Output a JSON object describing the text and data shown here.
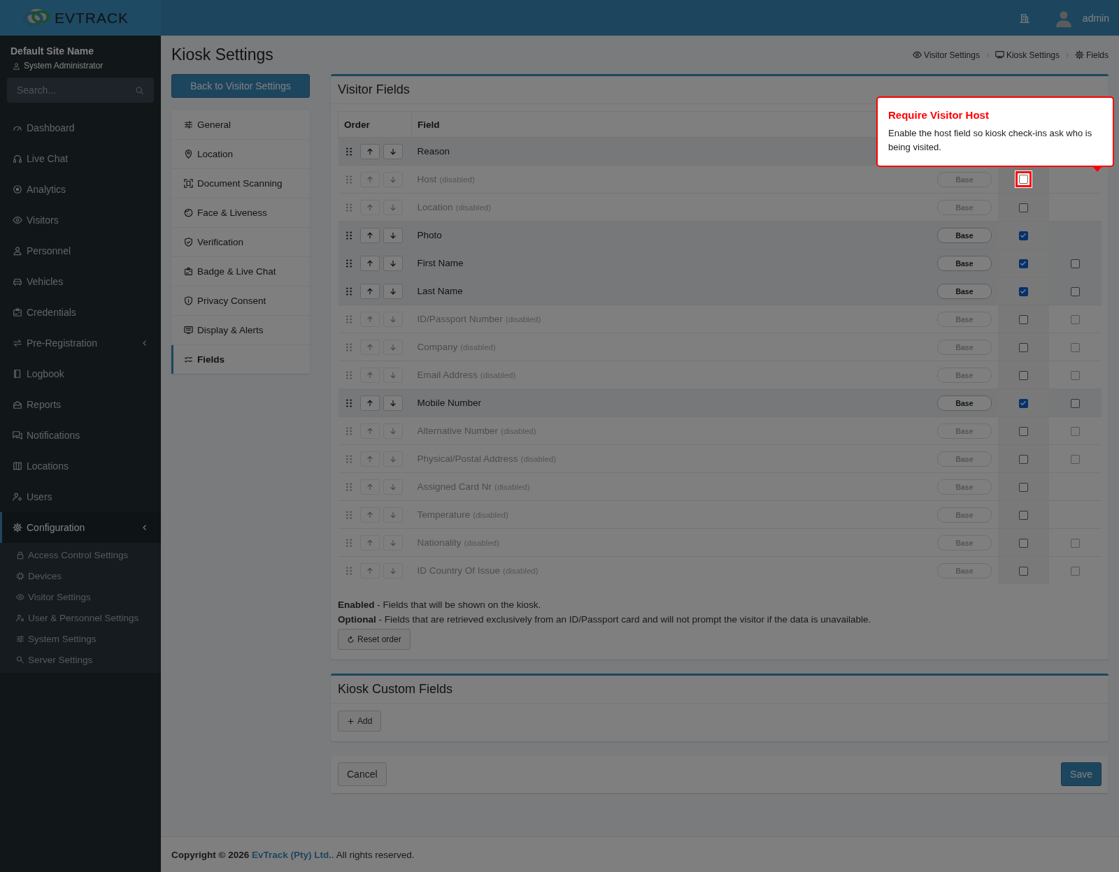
{
  "topbar": {
    "logo_text": "**EV**TRACK",
    "user": "admin"
  },
  "sidebar": {
    "site_name": "Default Site Name",
    "role": "System Administrator",
    "search": {
      "placeholder": "Search..."
    },
    "items": [
      {
        "label": "Dashboard",
        "kind": "link",
        "selected": false
      },
      {
        "label": "Live Chat",
        "kind": "link",
        "selected": false
      },
      {
        "label": "Analytics",
        "kind": "link",
        "selected": false
      },
      {
        "label": "Visitors",
        "kind": "link",
        "selected": false
      },
      {
        "label": "Personnel",
        "kind": "link",
        "selected": false
      },
      {
        "label": "Vehicles",
        "kind": "link",
        "selected": false
      },
      {
        "label": "Credentials",
        "kind": "link",
        "selected": false
      },
      {
        "label": "Pre-Registration",
        "kind": "group",
        "selected": false
      },
      {
        "label": "Logbook",
        "kind": "link",
        "selected": false
      },
      {
        "label": "Reports",
        "kind": "link",
        "selected": false
      },
      {
        "label": "Notifications",
        "kind": "link",
        "selected": false
      },
      {
        "label": "Locations",
        "kind": "link",
        "selected": false
      },
      {
        "label": "Users",
        "kind": "link",
        "selected": false
      },
      {
        "label": "Configuration",
        "kind": "group",
        "selected": true,
        "children": [
          {
            "label": "Access Control Settings"
          },
          {
            "label": "Devices"
          },
          {
            "label": "Visitor Settings"
          },
          {
            "label": "User & Personnel Settings"
          },
          {
            "label": "System Settings"
          },
          {
            "label": "Server Settings"
          }
        ]
      }
    ]
  },
  "page": {
    "title": "Kiosk Settings",
    "back_button": "Back to Visitor Settings",
    "breadcrumb": [
      "Visitor Settings",
      "Kiosk Settings",
      "Fields"
    ],
    "menu": [
      {
        "label": "General",
        "selected": false
      },
      {
        "label": "Location",
        "selected": false
      },
      {
        "label": "Document Scanning",
        "selected": false
      },
      {
        "label": "Face & Liveness",
        "selected": false
      },
      {
        "label": "Verification",
        "selected": false
      },
      {
        "label": "Badge & Live Chat",
        "selected": false
      },
      {
        "label": "Privacy Consent",
        "selected": false
      },
      {
        "label": "Display & Alerts",
        "selected": false
      },
      {
        "label": "Fields",
        "selected": true
      }
    ]
  },
  "visitor_fields": {
    "title": "Visitor Fields",
    "columns": [
      "Order",
      "Field"
    ],
    "rows": [
      {
        "field": "Reason",
        "disabled": false
      },
      {
        "field": "Host",
        "note": "(disabled)",
        "disabled": true,
        "badge": "Base",
        "enabled": false,
        "highlighted": true
      },
      {
        "field": "Location",
        "note": "(disabled)",
        "disabled": true,
        "badge": "Base",
        "enabled": false,
        "highlighted": false
      },
      {
        "field": "Photo",
        "disabled": false,
        "badge": "Base",
        "enabled": true,
        "highlighted": false
      },
      {
        "field": "First Name",
        "disabled": false,
        "badge": "Base",
        "enabled": true,
        "optional": false,
        "highlighted": false
      },
      {
        "field": "Last Name",
        "disabled": false,
        "badge": "Base",
        "enabled": true,
        "optional": false,
        "highlighted": false
      },
      {
        "field": "ID/Passport Number",
        "note": "(disabled)",
        "disabled": true,
        "badge": "Base",
        "enabled": false,
        "optional": false,
        "highlighted": false
      },
      {
        "field": "Company",
        "note": "(disabled)",
        "disabled": true,
        "badge": "Base",
        "enabled": false,
        "optional": false,
        "highlighted": false
      },
      {
        "field": "Email Address",
        "note": "(disabled)",
        "disabled": true,
        "badge": "Base",
        "enabled": false,
        "optional": false,
        "highlighted": false
      },
      {
        "field": "Mobile Number",
        "disabled": false,
        "badge": "Base",
        "enabled": true,
        "optional": false,
        "highlighted": false
      },
      {
        "field": "Alternative Number",
        "note": "(disabled)",
        "disabled": true,
        "badge": "Base",
        "enabled": false,
        "optional": false,
        "highlighted": false
      },
      {
        "field": "Physical/Postal Address",
        "note": "(disabled)",
        "disabled": true,
        "badge": "Base",
        "enabled": false,
        "optional": false,
        "highlighted": false
      },
      {
        "field": "Assigned Card Nr",
        "note": "(disabled)",
        "disabled": true,
        "badge": "Base",
        "enabled": false,
        "highlighted": false
      },
      {
        "field": "Temperature",
        "note": "(disabled)",
        "disabled": true,
        "badge": "Base",
        "enabled": false,
        "highlighted": false
      },
      {
        "field": "Nationality",
        "note": "(disabled)",
        "disabled": true,
        "badge": "Base",
        "enabled": false,
        "optional": false,
        "highlighted": false
      },
      {
        "field": "ID Country Of Issue",
        "note": "(disabled)",
        "disabled": true,
        "badge": "Base",
        "enabled": false,
        "optional": false,
        "highlighted": false
      }
    ],
    "notes": [
      "**Enabled** - Fields that will be shown on the kiosk.",
      "**Optional** - Fields that are retrieved exclusively from an ID/Passport card and will not prompt the visitor if the data is unavailable."
    ],
    "reset_button": "Reset order"
  },
  "custom_fields": {
    "title": "Kiosk Custom Fields",
    "add_button": "Add"
  },
  "actions": {
    "cancel": "Cancel",
    "save": "Save"
  },
  "tooltip": {
    "title": "Require Visitor Host",
    "text": "Enable the host field so kiosk check-ins ask who is being visited."
  },
  "footer": {
    "prefix": "Copyright © 2026",
    "link": "EvTrack (Pty) Ltd.",
    "suffix": ". All rights reserved."
  }
}
